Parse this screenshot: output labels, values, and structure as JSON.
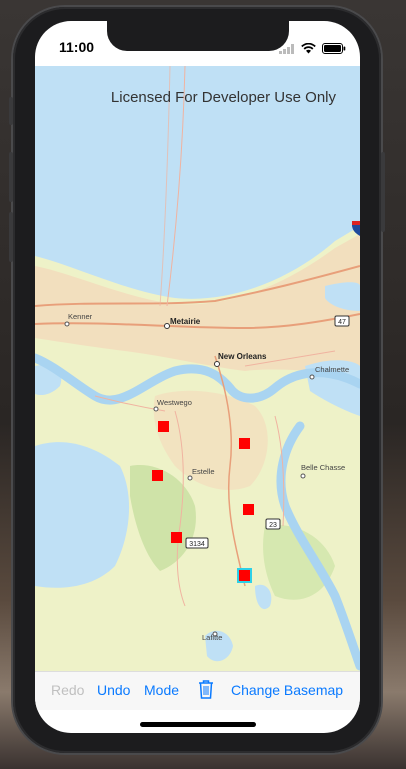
{
  "status_bar": {
    "time": "11:00"
  },
  "map": {
    "attribution": "Licensed For Developer Use Only",
    "places": [
      "Metairie",
      "Kenner",
      "New Orleans",
      "Chalmette",
      "Westwego",
      "Estelle",
      "Belle Chasse",
      "Lafitte"
    ],
    "shields": [
      "47",
      "23",
      "3134"
    ],
    "markers": [
      {
        "name": "marker-1",
        "selected": false
      },
      {
        "name": "marker-2",
        "selected": false
      },
      {
        "name": "marker-3",
        "selected": false
      },
      {
        "name": "marker-4",
        "selected": false
      },
      {
        "name": "marker-5",
        "selected": false
      },
      {
        "name": "marker-6",
        "selected": true
      }
    ]
  },
  "toolbar": {
    "redo_label": "Redo",
    "undo_label": "Undo",
    "mode_label": "Mode",
    "delete_icon": "trash-icon",
    "change_basemap_label": "Change Basemap"
  },
  "colors": {
    "accent": "#0a7aff",
    "disabled": "#c0c0c0",
    "water": "#bfe0f5",
    "land": "#eef2c8",
    "urban": "#f2dfbe",
    "marker": "#ff0000",
    "selection": "#2dd0e8"
  }
}
